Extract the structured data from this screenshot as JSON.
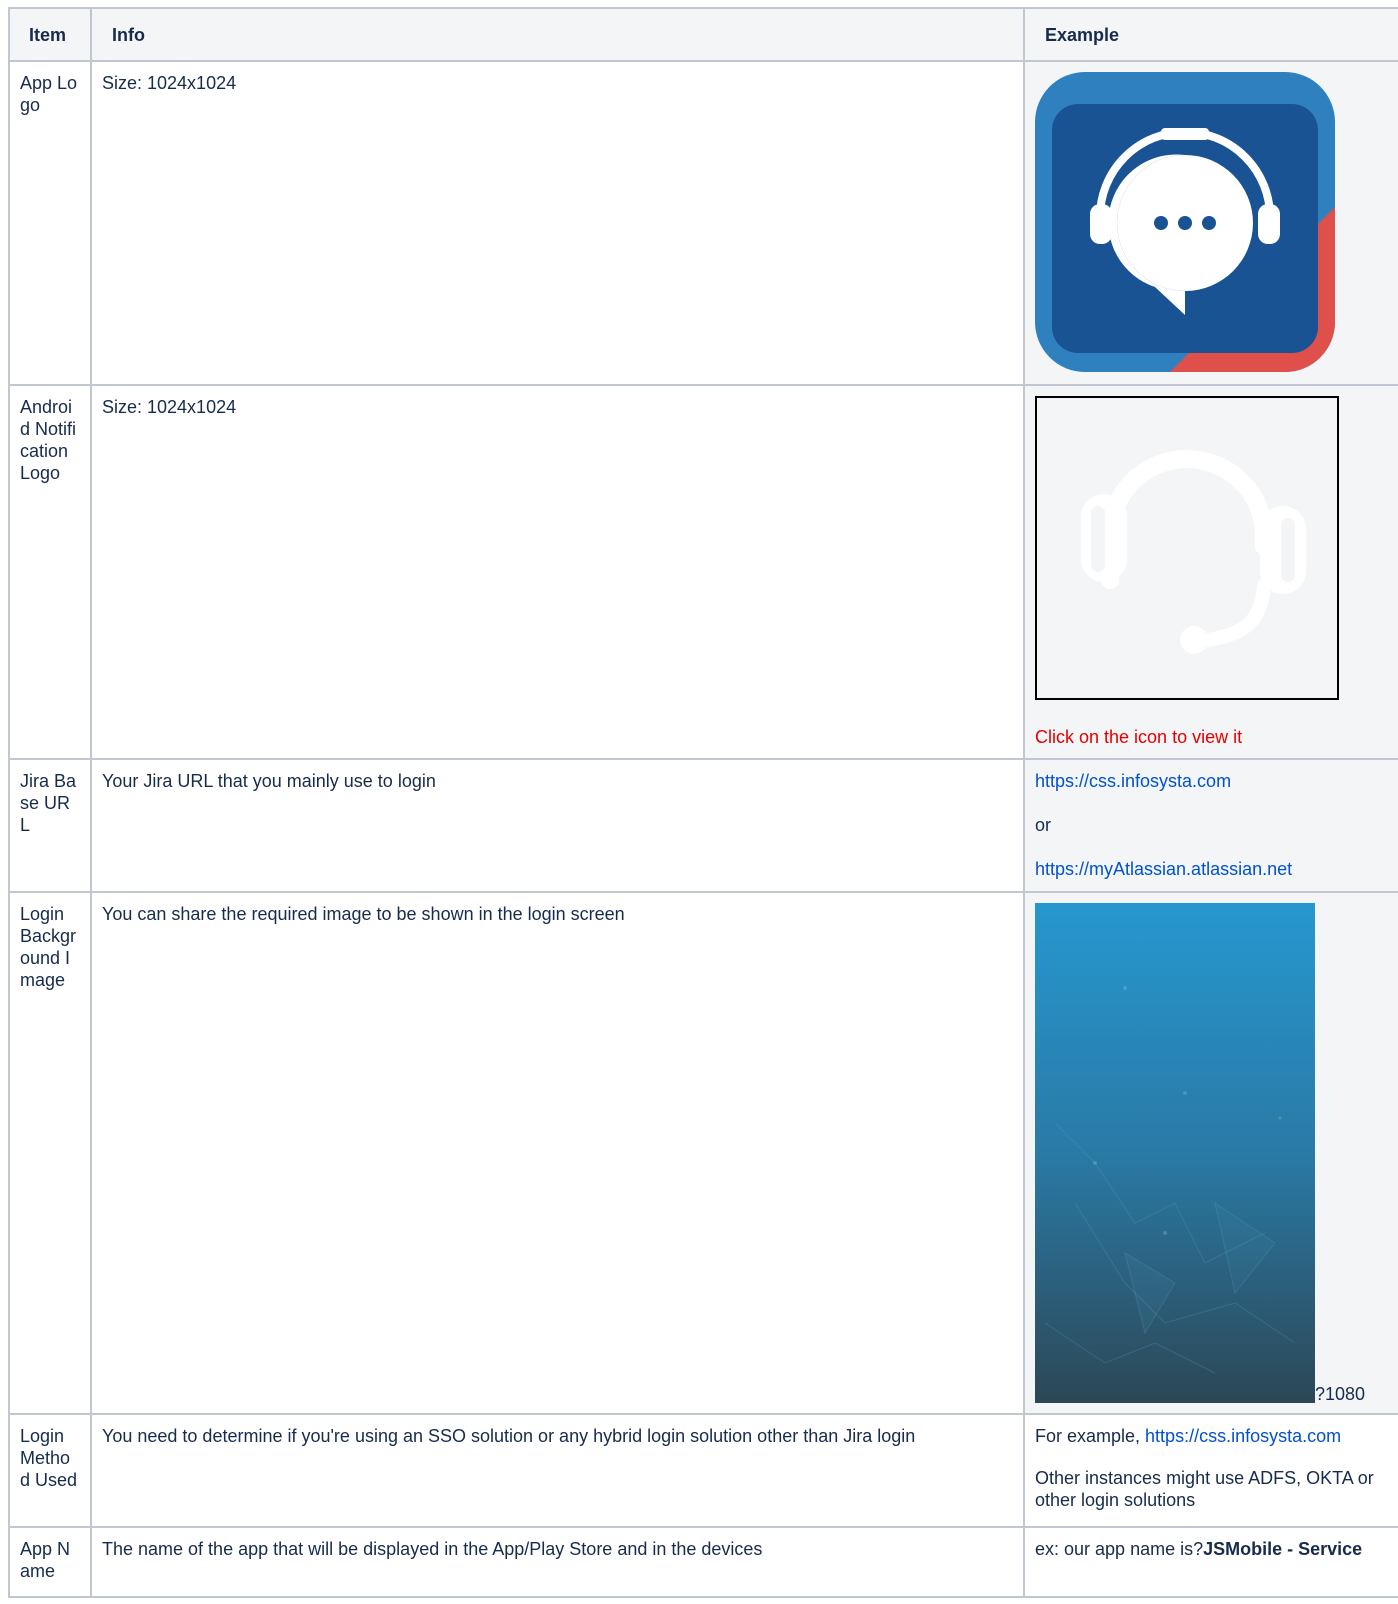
{
  "table": {
    "headers": [
      "Item",
      "Info",
      "Example"
    ],
    "rows": [
      {
        "item": "App Logo",
        "info": "Size: 1024x1024"
      },
      {
        "item": "Android Notification Logo",
        "info": "Size: 1024x1024",
        "note": "Click on the icon to view it"
      },
      {
        "item": "Jira Base URL",
        "info": "Your Jira URL that you mainly use to login",
        "link1": "https://css.infosysta.com",
        "or": "or",
        "link2": "https://myAtlassian.atlassian.net"
      },
      {
        "item": "Login Background Image",
        "info": "You can share the required image to be shown in the login screen",
        "size_suffix": "?1080"
      },
      {
        "item": "Login Method Used",
        "info": "You need to determine if you're using an SSO solution or any hybrid login solution other than Jira login",
        "example_prefix": "For example, ",
        "example_link": "https://css.infosysta.com",
        "example_rest": "Other instances might use ADFS, OKTA or other login solutions"
      },
      {
        "item": "App Name",
        "info": "The name of the app that will be displayed in the App/Play Store and in the devices",
        "example_prefix": "ex: our app name is?",
        "example_bold": "JSMobile - Service"
      }
    ]
  },
  "colors": {
    "logo_outer": "#2f80bf",
    "logo_inner": "#1a5394",
    "logo_accent": "#e0504a",
    "link": "#0052cc",
    "note": "#e60000"
  }
}
